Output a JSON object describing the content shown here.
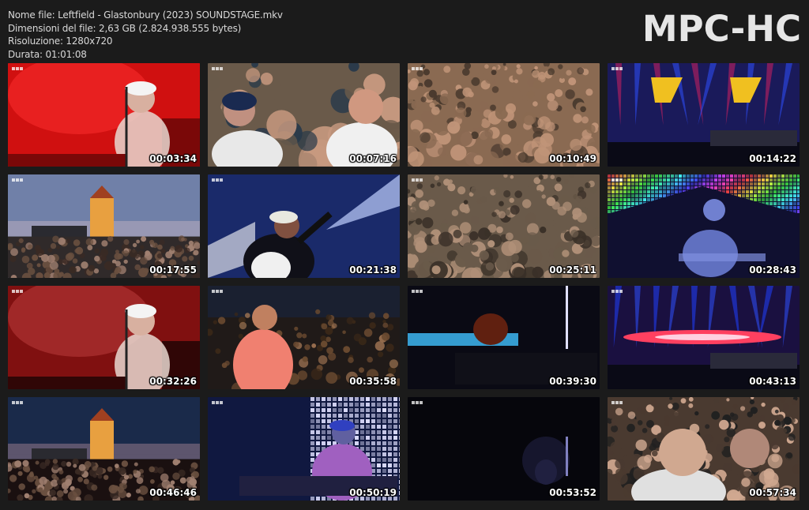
{
  "info": {
    "file_name": "Nome file: Leftfield - Glastonbury (2023) SOUNDSTAGE.mkv",
    "file_size": "Dimensioni del file: 2,63 GB (2.824.938.555 bytes)",
    "resolution": "Risoluzione: 1280x720",
    "duration": "Durata: 01:01:08"
  },
  "brand": "MPC-HC",
  "thumbnails": [
    {
      "time": "00:03:34",
      "scene": "dj-red",
      "colors": [
        "#d01010",
        "#ff3030",
        "#7a0808"
      ]
    },
    {
      "time": "00:07:16",
      "scene": "crowd-close",
      "colors": [
        "#6a5a4a",
        "#c89a80",
        "#2a3a4a"
      ]
    },
    {
      "time": "00:10:49",
      "scene": "crowd-dense",
      "colors": [
        "#8a6a52",
        "#c09478",
        "#4a3a2e"
      ]
    },
    {
      "time": "00:14:22",
      "scene": "stage-lights",
      "colors": [
        "#1a1a5a",
        "#f0c020",
        "#d02060"
      ]
    },
    {
      "time": "00:17:55",
      "scene": "festival-dusk",
      "colors": [
        "#7080a8",
        "#c0b0c0",
        "#302a2a"
      ]
    },
    {
      "time": "00:21:38",
      "scene": "vocalist-blue",
      "colors": [
        "#1a2a6a",
        "#c0d0ff",
        "#101018"
      ]
    },
    {
      "time": "00:25:11",
      "scene": "crowd-dense",
      "colors": [
        "#6a5a4a",
        "#b09078",
        "#3a3028"
      ]
    },
    {
      "time": "00:28:43",
      "scene": "drummer-led",
      "colors": [
        "#101030",
        "#6080ff",
        "#ff6060"
      ]
    },
    {
      "time": "00:32:26",
      "scene": "dj-red-dark",
      "colors": [
        "#801010",
        "#c04040",
        "#300606"
      ]
    },
    {
      "time": "00:35:58",
      "scene": "night-crowd",
      "colors": [
        "#201a18",
        "#f08070",
        "#403020"
      ]
    },
    {
      "time": "00:39:30",
      "scene": "dark-stage",
      "colors": [
        "#0a0a14",
        "#40c0ff",
        "#602010"
      ]
    },
    {
      "time": "00:43:13",
      "scene": "pink-beam",
      "colors": [
        "#1a1040",
        "#ff4060",
        "#2040ff"
      ]
    },
    {
      "time": "00:46:46",
      "scene": "festival-night",
      "colors": [
        "#1a2a4a",
        "#a08090",
        "#1a1010"
      ]
    },
    {
      "time": "00:50:19",
      "scene": "dj-led-wall",
      "colors": [
        "#101840",
        "#80a0ff",
        "#e0e0ff"
      ]
    },
    {
      "time": "00:53:52",
      "scene": "very-dark",
      "colors": [
        "#06060c",
        "#303060",
        "#101018"
      ]
    },
    {
      "time": "00:57:34",
      "scene": "audience-faces",
      "colors": [
        "#4a3a30",
        "#d0a890",
        "#202020"
      ]
    }
  ]
}
